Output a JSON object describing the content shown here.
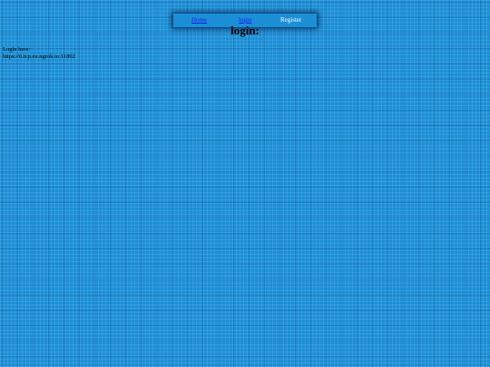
{
  "nav": {
    "home_label": "Home",
    "login_label": "login",
    "register_label": "Register"
  },
  "page": {
    "title": "login:",
    "login_here_text": "Login here:",
    "login_url": "https://0.tcp.eu.ngrok.io:11802"
  },
  "colors": {
    "background": "#1b8fd6",
    "link": "#1a1aee",
    "nav_text": "#ffffff"
  }
}
